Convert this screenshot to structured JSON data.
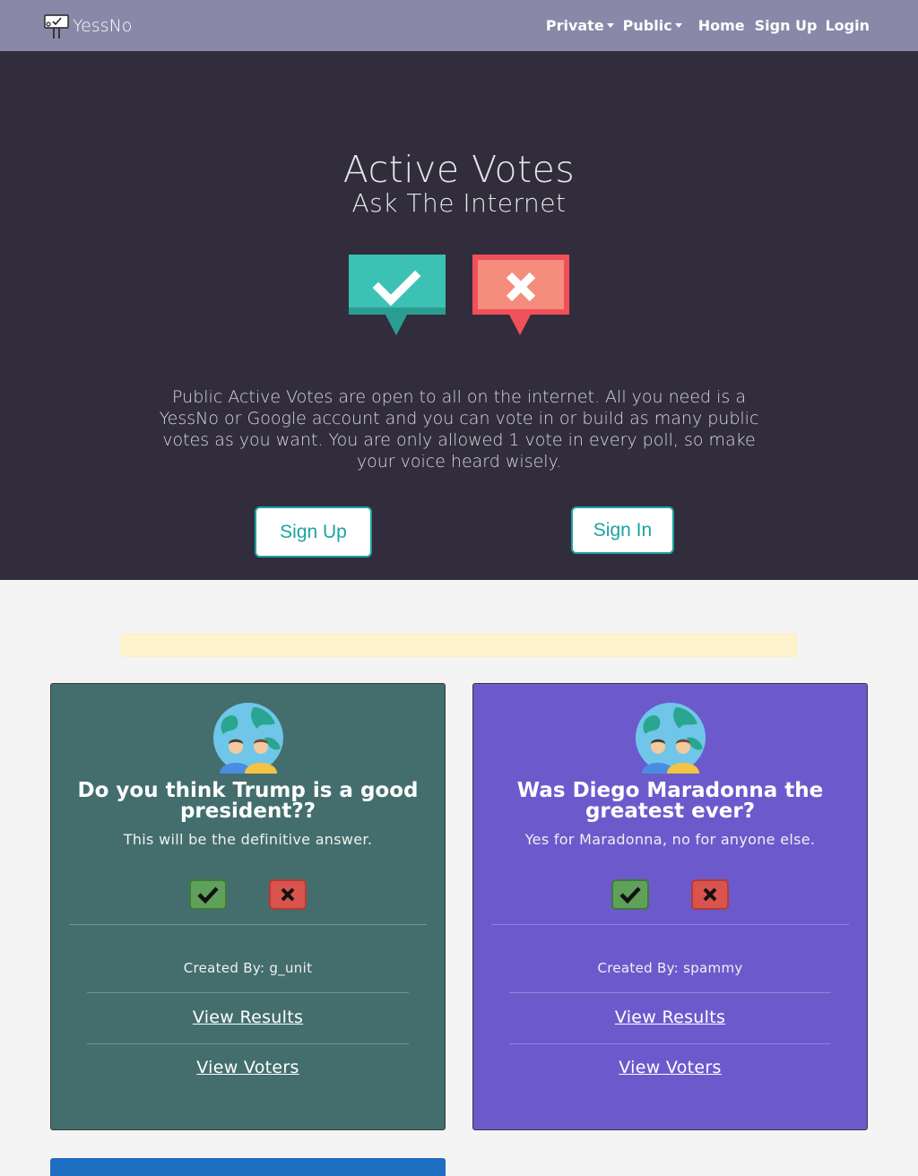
{
  "navbar": {
    "brand": "YessNo",
    "items": [
      {
        "label": "Private",
        "dropdown": true
      },
      {
        "label": "Public",
        "dropdown": true
      },
      {
        "label": "Home"
      },
      {
        "label": "Sign Up"
      },
      {
        "label": "Login"
      }
    ]
  },
  "hero": {
    "title": "Active Votes",
    "subtitle": "Ask The Internet",
    "icons": [
      "check-speech-icon",
      "x-speech-icon"
    ],
    "description": "Public Active Votes are open to all on the internet. All you need is a YessNo or Google account and you can vote in or build as many public votes as you want. You are only allowed 1 vote in every poll, so make your voice heard wisely.",
    "signup_label": "Sign Up",
    "signin_label": "Sign In"
  },
  "alert": {
    "text": ""
  },
  "polls": [
    {
      "title": "Do you think Trump is a good president??",
      "description": "This will be the definitive answer.",
      "creator": "Created By: g_unit",
      "results_label": "View Results",
      "voters_label": "View Voters",
      "color": "#436e6d"
    },
    {
      "title": "Was Diego Maradonna the greatest ever?",
      "description": "Yes for Maradonna, no for anyone else.",
      "creator": "Created By: spammy",
      "results_label": "View Results",
      "voters_label": "View Voters",
      "color": "#6c5acd"
    }
  ],
  "colors": {
    "navbar": "#8a88a8",
    "hero": "#312d3d",
    "accent": "#1aa3a3",
    "yes": "#5fa05a",
    "no": "#d9534f",
    "next_card": "#1e6fc2"
  }
}
